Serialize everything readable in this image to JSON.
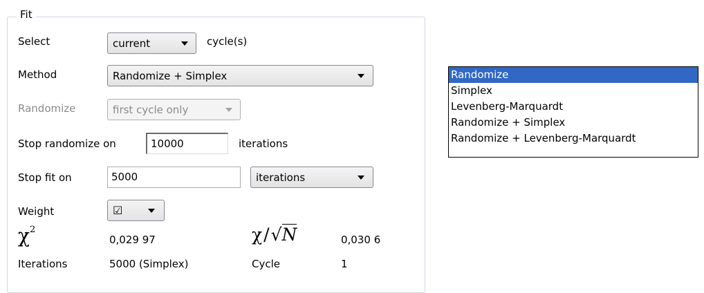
{
  "fit": {
    "legend": "Fit",
    "select": {
      "label": "Select",
      "value": "current",
      "suffix": "cycle(s)"
    },
    "method": {
      "label": "Method",
      "value": "Randomize + Simplex"
    },
    "randomize": {
      "label": "Randomize",
      "value": "first cycle only"
    },
    "stop_randomize": {
      "label": "Stop randomize on",
      "value": "10000",
      "suffix": "iterations"
    },
    "stop_fit": {
      "label": "Stop fit on",
      "value": "5000",
      "unit": "iterations"
    },
    "weight": {
      "label": "Weight",
      "value": "☑"
    },
    "chi2": {
      "symbol": "χ",
      "superscript": "2",
      "value": "0,029 97"
    },
    "chi_sqrtN": {
      "chi": "χ",
      "sep": "/",
      "sqrt": "√",
      "N": "N",
      "value": "0,030 6"
    },
    "iterations": {
      "label": "Iterations",
      "value": "5000 (Simplex)"
    },
    "cycle": {
      "label": "Cycle",
      "value": "1"
    }
  },
  "method_list": {
    "items": [
      "Randomize",
      "Simplex",
      "Levenberg-Marquardt",
      "Randomize + Simplex",
      "Randomize + Levenberg-Marquardt"
    ],
    "selected_index": 0
  }
}
